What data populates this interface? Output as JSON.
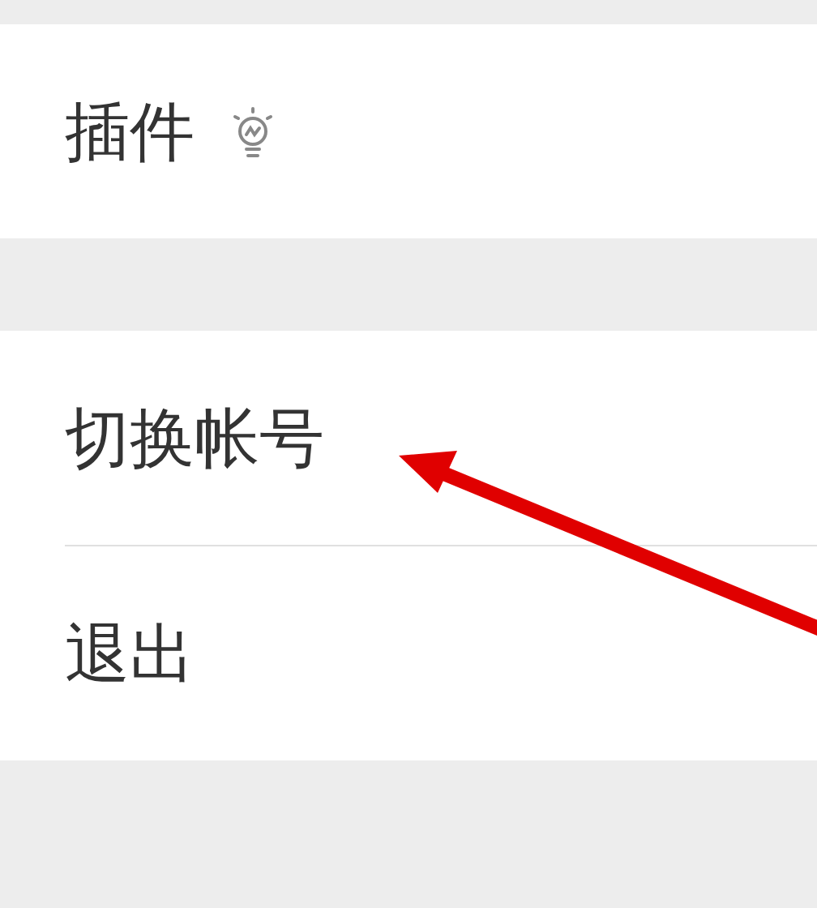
{
  "groups": [
    {
      "items": [
        {
          "label": "插件",
          "kind": "tip"
        }
      ]
    },
    {
      "items": [
        {
          "label": "切换帐号",
          "kind": "plain"
        },
        {
          "label": "退出",
          "kind": "plain"
        }
      ]
    }
  ]
}
